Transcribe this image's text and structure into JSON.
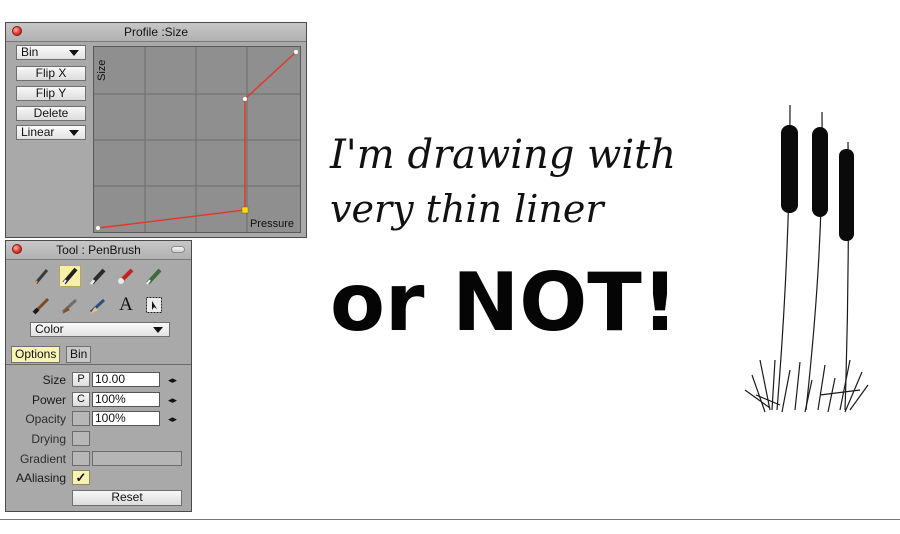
{
  "profile_panel": {
    "title": "Profile :Size",
    "bin_dropdown": "Bin",
    "buttons": [
      "Flip X",
      "Flip Y",
      "Delete"
    ],
    "curve_dropdown": "Linear",
    "y_axis_label": "Size",
    "x_axis_label": "Pressure"
  },
  "tool_panel": {
    "title": "Tool : PenBrush",
    "tools_row1": [
      "pencil-icon",
      "pen-icon",
      "marker-icon",
      "airbrush-icon",
      "eraser-pen-icon"
    ],
    "tools_row2": [
      "brush-icon",
      "flat-brush-icon",
      "fan-brush-icon",
      "text-tool-icon",
      "selection-tool-icon"
    ],
    "text_tool_glyph": "A",
    "color_dropdown": "Color",
    "tabs": [
      "Options",
      "Bin"
    ],
    "rows": {
      "size": {
        "label": "Size",
        "mode": "P",
        "value": "10.00"
      },
      "power": {
        "label": "Power",
        "mode": "C",
        "value": "100%"
      },
      "opacity": {
        "label": "Opacity",
        "value": "100%"
      },
      "drying": {
        "label": "Drying"
      },
      "gradient": {
        "label": "Gradient"
      },
      "aaliasing": {
        "label": "AAliasing",
        "checked": "✓"
      }
    },
    "reset_button": "Reset"
  },
  "canvas": {
    "handwriting_line1": "I'm drawing with",
    "handwriting_line2": "very thin liner",
    "bold_text": "or NOT!"
  }
}
